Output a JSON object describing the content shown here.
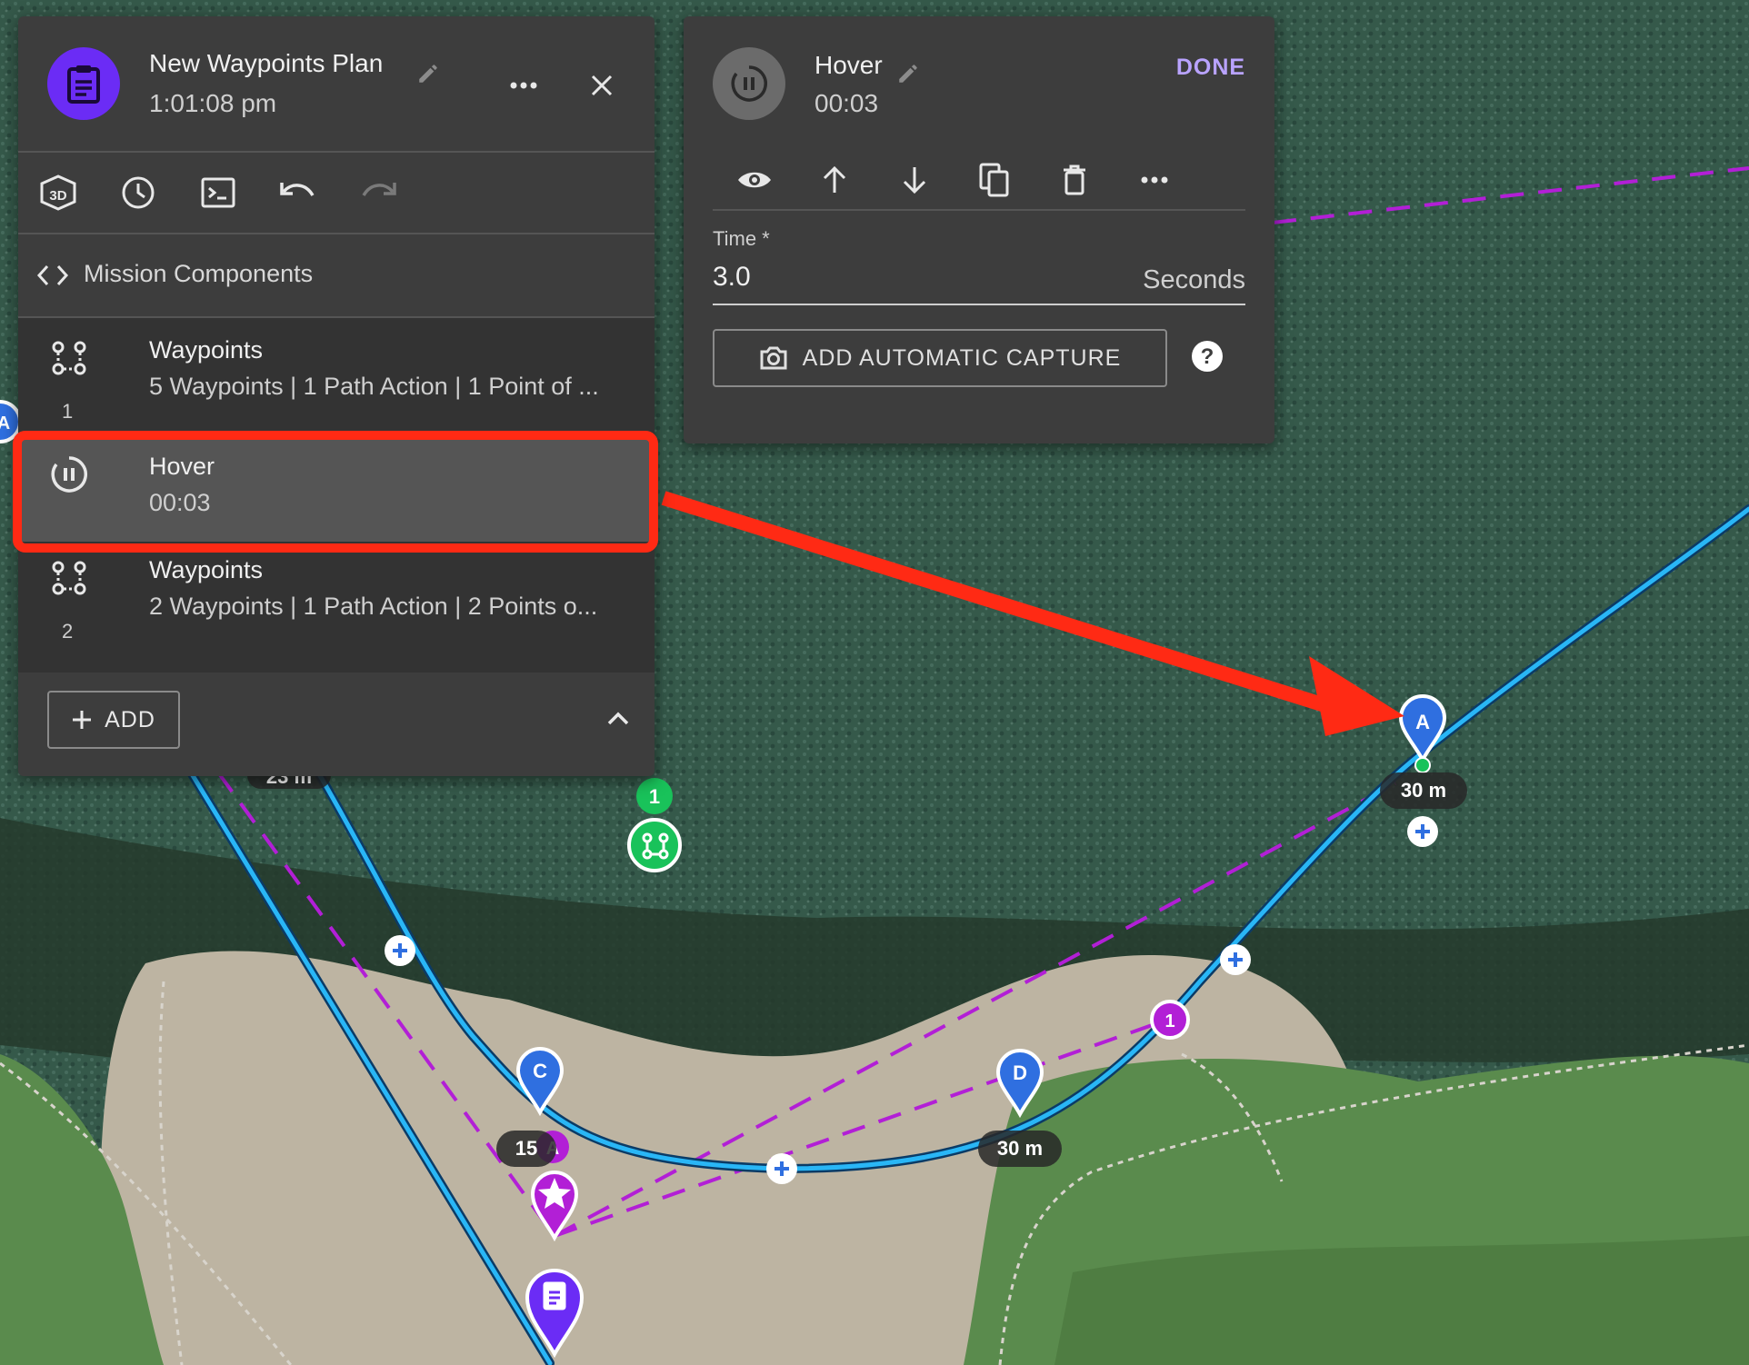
{
  "plan": {
    "title": "New Waypoints Plan",
    "time": "1:01:08 pm",
    "icons": [
      "clipboard-icon",
      "pencil-icon",
      "more-horiz-icon",
      "close-icon"
    ]
  },
  "toolbar": {
    "buttons": [
      "3d-view-icon",
      "history-icon",
      "console-icon",
      "undo-icon",
      "redo-icon"
    ]
  },
  "mission_components": {
    "label": "Mission Components",
    "icon": "code-brackets-icon"
  },
  "components": [
    {
      "title": "Waypoints",
      "subtitle": "5 Waypoints | 1 Path Action | 1 Point of ...",
      "number": "1",
      "icon": "waypoints-icon"
    },
    {
      "title": "Hover",
      "subtitle": "00:03",
      "number": "",
      "icon": "hover-pause-icon",
      "selected": true
    },
    {
      "title": "Waypoints",
      "subtitle": "2 Waypoints | 1 Path Action | 2 Points o...",
      "number": "2",
      "icon": "waypoints-icon"
    }
  ],
  "footer": {
    "add_label": "ADD",
    "icons": [
      "plus-icon",
      "chevron-up-icon"
    ]
  },
  "hover_panel": {
    "title": "Hover",
    "subtitle": "00:03",
    "done_label": "DONE",
    "actions": [
      "eye-icon",
      "arrow-up-icon",
      "arrow-down-icon",
      "copy-icon",
      "delete-icon",
      "more-horiz-icon"
    ],
    "time_label": "Time *",
    "time_value": "3.0",
    "time_unit": "Seconds",
    "capture_label": "ADD AUTOMATIC CAPTURE",
    "help_icon": "help-icon"
  },
  "map": {
    "labels": {
      "a_alt": "30 m",
      "d_alt": "30 m",
      "c_alt": "15",
      "left_alt": "23 m"
    },
    "markers": {
      "a": "A",
      "c": "C",
      "d": "D",
      "poi_a": "A",
      "action_1": "1",
      "component_1": "1",
      "left_a": "A"
    },
    "colors": {
      "path": "#29b6f6",
      "poi_line": "#b21fd6",
      "annotation": "#ff2a14",
      "waypoint_pin": "#2f6fe0",
      "poi_pin": "#b21fd6",
      "start_pin": "#6b2cf5",
      "component_badge": "#19c25a"
    }
  }
}
